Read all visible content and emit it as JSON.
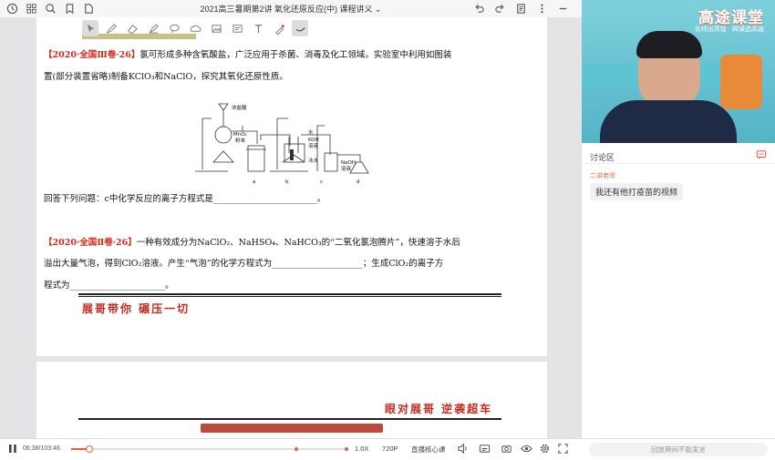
{
  "titlebar": {
    "title": "2021高三暑期第2讲 氧化还原反应(中) 课程讲义 ⌄",
    "left_icons": [
      "clock-icon",
      "grid-icon",
      "search-icon",
      "bookmark-icon",
      "file-icon"
    ],
    "right_icons": [
      "undo-icon",
      "redo-icon",
      "document-icon",
      "more-icon",
      "minimize-icon"
    ]
  },
  "toolbar": {
    "tools": [
      "select-tool-icon",
      "pen-icon",
      "eraser-icon",
      "highlighter-icon",
      "lasso-icon",
      "image-icon",
      "insert-image-icon",
      "text-box-icon",
      "text-icon",
      "pipette-icon",
      "undo-stroke-icon"
    ]
  },
  "document": {
    "q1_tag": "【2020·全国Ⅲ卷·26】",
    "q1_line1": "氯可形成多种含氧酸盐，广泛应用于杀菌、消毒及化工领域。实验室中利用如图装",
    "q1_line2": "置(部分装置省略)制备KClO₃和NaClO，探究其氧化还原性质。",
    "apparatus": {
      "labels": {
        "conc_hcl": "浓盐酸",
        "mno2": "MnO₂",
        "powder": "粉末",
        "water": "水",
        "koh": "KOH",
        "koh_sol": "溶液",
        "ice_water": "冰水",
        "naoh": "NaOH",
        "naoh_sol": "溶液",
        "a": "a",
        "b": "b",
        "c": "c",
        "d": "d"
      }
    },
    "q1_prompt": "回答下列问题：c中化学反应的离子方程式是________________________。",
    "q2_tag": "【2020·全国Ⅱ卷·26】",
    "q2_line1": "一种有效成分为NaClO₂、NaHSO₄、NaHCO₃的“二氧化氯泡腾片”，快速溶于水后",
    "q2_line2": "溢出大量气泡，得到ClO₂溶液。产生“气泡”的化学方程式为_____________________；生成ClO₂的离子方",
    "q2_line3": "程式为______________________。",
    "handwriting1": "展哥带你 碾压一切",
    "handwriting2": "眼对展哥 逆袭超车"
  },
  "video": {
    "brand_title": "高途课堂",
    "brand_sub": "名师出高徒 · 网课选高途"
  },
  "discussion": {
    "label": "讨论区",
    "messages": [
      {
        "sender": "二讲老师",
        "text": "我还有他打疫苗的视频"
      }
    ]
  },
  "player": {
    "time": "06:38/103:46",
    "progress": 0.064,
    "speed": "1.0X",
    "quality": "720P",
    "mode": "直播核心课",
    "replay_placeholder": "回放期间不能发言"
  },
  "colors": {
    "accent": "#ef5b3c",
    "red_text": "#d12a1a"
  }
}
